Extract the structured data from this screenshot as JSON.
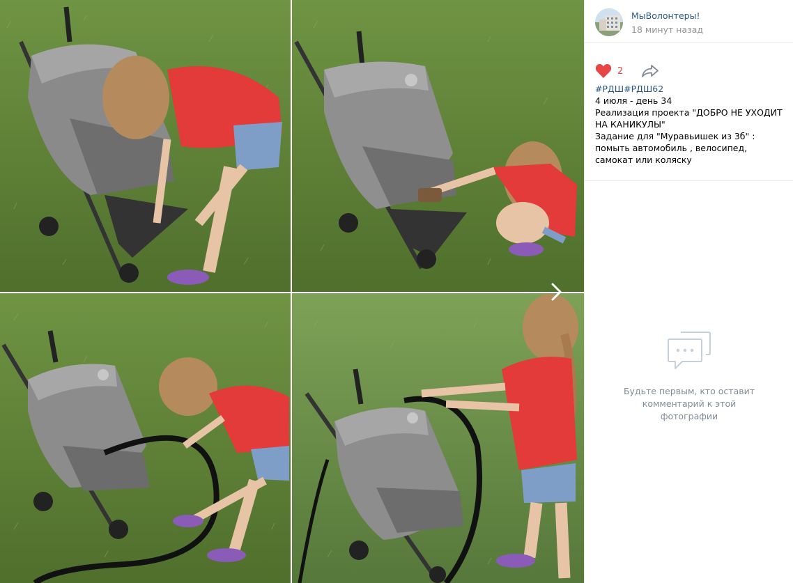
{
  "author": {
    "name": "МыВолонтеры!",
    "time": "18 минут назад",
    "avatar_icon": "building-avatar-icon"
  },
  "actions": {
    "like_count": "2",
    "like_icon": "heart-icon",
    "share_icon": "share-arrow-icon",
    "like_color": "#e64646"
  },
  "post": {
    "hashtags": "#РДШ#РДШ62",
    "line1": "4 июля - день 34",
    "line2": "Реализация проекта \"ДОБРО НЕ УХОДИТ НА КАНИКУЛЫ\"",
    "line3": "Задание для \"Муравьишек из 3б\" : помыть автомобиль , велосипед, самокат или коляску"
  },
  "comments": {
    "empty_text": "Будьте первым, кто оставит комментарий к этой фотографии",
    "empty_icon": "comment-bubble-icon"
  },
  "viewer": {
    "next_icon": "chevron-right-icon"
  }
}
